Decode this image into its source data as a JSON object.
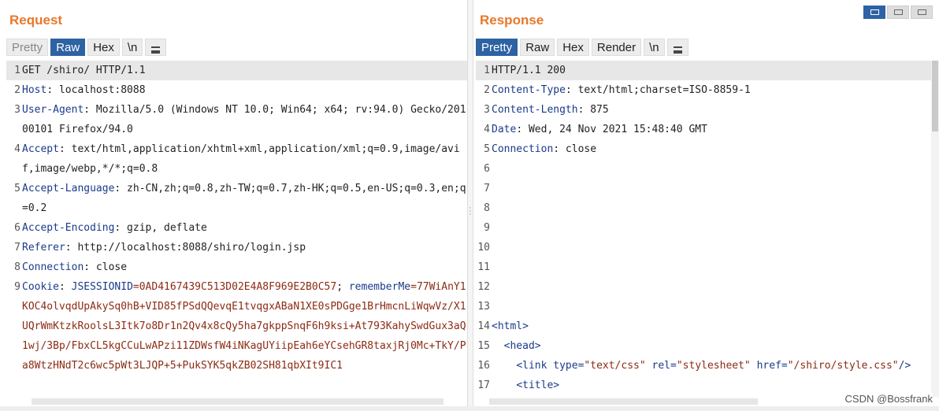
{
  "request": {
    "title": "Request",
    "tabs": [
      "Pretty",
      "Raw",
      "Hex",
      "\\n"
    ],
    "active_tab": "Raw",
    "lines": [
      {
        "n": "1",
        "parts": [
          {
            "t": "GET /shiro/ HTTP/1.1",
            "c": "plain"
          }
        ]
      },
      {
        "n": "2",
        "parts": [
          {
            "t": "Host",
            "c": "hdr"
          },
          {
            "t": ": localhost:8088",
            "c": "plain"
          }
        ]
      },
      {
        "n": "3",
        "parts": [
          {
            "t": "User-Agent",
            "c": "hdr"
          },
          {
            "t": ": Mozilla/5.0 (Windows NT 10.0; Win64; x64; rv:94.0) Gecko/20100101 Firefox/94.0",
            "c": "plain"
          }
        ]
      },
      {
        "n": "4",
        "parts": [
          {
            "t": "Accept",
            "c": "hdr"
          },
          {
            "t": ": text/html,application/xhtml+xml,application/xml;q=0.9,image/avif,image/webp,*/*;q=0.8",
            "c": "plain"
          }
        ]
      },
      {
        "n": "5",
        "parts": [
          {
            "t": "Accept-Language",
            "c": "hdr"
          },
          {
            "t": ": zh-CN,zh;q=0.8,zh-TW;q=0.7,zh-HK;q=0.5,en-US;q=0.3,en;q=0.2",
            "c": "plain"
          }
        ]
      },
      {
        "n": "6",
        "parts": [
          {
            "t": "Accept-Encoding",
            "c": "hdr"
          },
          {
            "t": ": gzip, deflate",
            "c": "plain"
          }
        ]
      },
      {
        "n": "7",
        "parts": [
          {
            "t": "Referer",
            "c": "hdr"
          },
          {
            "t": ": http://localhost:8088/shiro/login.jsp",
            "c": "plain"
          }
        ]
      },
      {
        "n": "8",
        "parts": [
          {
            "t": "Connection",
            "c": "hdr"
          },
          {
            "t": ": close",
            "c": "plain"
          }
        ]
      },
      {
        "n": "9",
        "parts": [
          {
            "t": "Cookie",
            "c": "hdr"
          },
          {
            "t": ": ",
            "c": "plain"
          },
          {
            "t": "JSESSIONID",
            "c": "hdr"
          },
          {
            "t": "=0AD4167439C513D02E4A8F969E2B0C57",
            "c": "cv"
          },
          {
            "t": "; ",
            "c": "plain"
          },
          {
            "t": "rememberMe",
            "c": "hdr"
          },
          {
            "t": "=77WiAnY1KOC4olvqdUpAkySq0hB+VID85fPSdQQevqE1tvqgxABaN1XE0sPDGge1BrHmcnLiWqwVz/X1UQrWmKtzkRoolsL3Itk7o8Dr1n2Qv4x8cQy5ha7gkppSnqF6h9ksi+At793KahySwdGux3aQ1wj/3Bp/FbxCL5kgCCuLwAPzi11ZDWsfW4iNKagUYiipEah6eYCsehGR8taxjRj0Mc+TkY/Pa8WtzHNdT2c6wc5pWt3LJQP+5+PukSYK5qkZB02SH81qbXIt9IC1",
            "c": "cv"
          }
        ]
      }
    ]
  },
  "response": {
    "title": "Response",
    "tabs": [
      "Pretty",
      "Raw",
      "Hex",
      "Render",
      "\\n"
    ],
    "active_tab": "Pretty",
    "lines": [
      {
        "n": "1",
        "parts": [
          {
            "t": "HTTP/1.1 200",
            "c": "plain"
          }
        ]
      },
      {
        "n": "2",
        "parts": [
          {
            "t": "Content-Type",
            "c": "hdr"
          },
          {
            "t": ": text/html;charset=ISO-8859-1",
            "c": "plain"
          }
        ]
      },
      {
        "n": "3",
        "parts": [
          {
            "t": "Content-Length",
            "c": "hdr"
          },
          {
            "t": ": 875",
            "c": "plain"
          }
        ]
      },
      {
        "n": "4",
        "parts": [
          {
            "t": "Date",
            "c": "hdr"
          },
          {
            "t": ": Wed, 24 Nov 2021 15:48:40 GMT",
            "c": "plain"
          }
        ]
      },
      {
        "n": "5",
        "parts": [
          {
            "t": "Connection",
            "c": "hdr"
          },
          {
            "t": ": close",
            "c": "plain"
          }
        ]
      },
      {
        "n": "6",
        "parts": []
      },
      {
        "n": "7",
        "parts": []
      },
      {
        "n": "8",
        "parts": []
      },
      {
        "n": "9",
        "parts": []
      },
      {
        "n": "10",
        "parts": []
      },
      {
        "n": "11",
        "parts": []
      },
      {
        "n": "12",
        "parts": []
      },
      {
        "n": "13",
        "parts": []
      },
      {
        "n": "14",
        "parts": [
          {
            "t": "<html>",
            "c": "tag"
          }
        ]
      },
      {
        "n": "15",
        "parts": [
          {
            "t": "  <head>",
            "c": "tag"
          }
        ]
      },
      {
        "n": "16",
        "parts": [
          {
            "t": "    <link ",
            "c": "tag"
          },
          {
            "t": "type=",
            "c": "tag"
          },
          {
            "t": "\"text/css\"",
            "c": "attr"
          },
          {
            "t": " rel=",
            "c": "tag"
          },
          {
            "t": "\"stylesheet\"",
            "c": "attr"
          },
          {
            "t": " href=",
            "c": "tag"
          },
          {
            "t": "\"/shiro/style.css\"",
            "c": "attr"
          },
          {
            "t": "/>",
            "c": "tag"
          }
        ]
      },
      {
        "n": "17",
        "parts": [
          {
            "t": "    <title>",
            "c": "tag"
          }
        ]
      }
    ]
  },
  "watermark": "CSDN @Bossfrank",
  "colors": {
    "accent": "#e8782a",
    "active_tab": "#2d62a3",
    "header_name": "#1a3a8a",
    "cookie_value": "#8c2b14"
  },
  "icons": {
    "menu": "hamburger-icon",
    "layout_split": "split-view-icon",
    "layout_horizontal": "horizontal-view-icon",
    "layout_single": "single-view-icon"
  }
}
